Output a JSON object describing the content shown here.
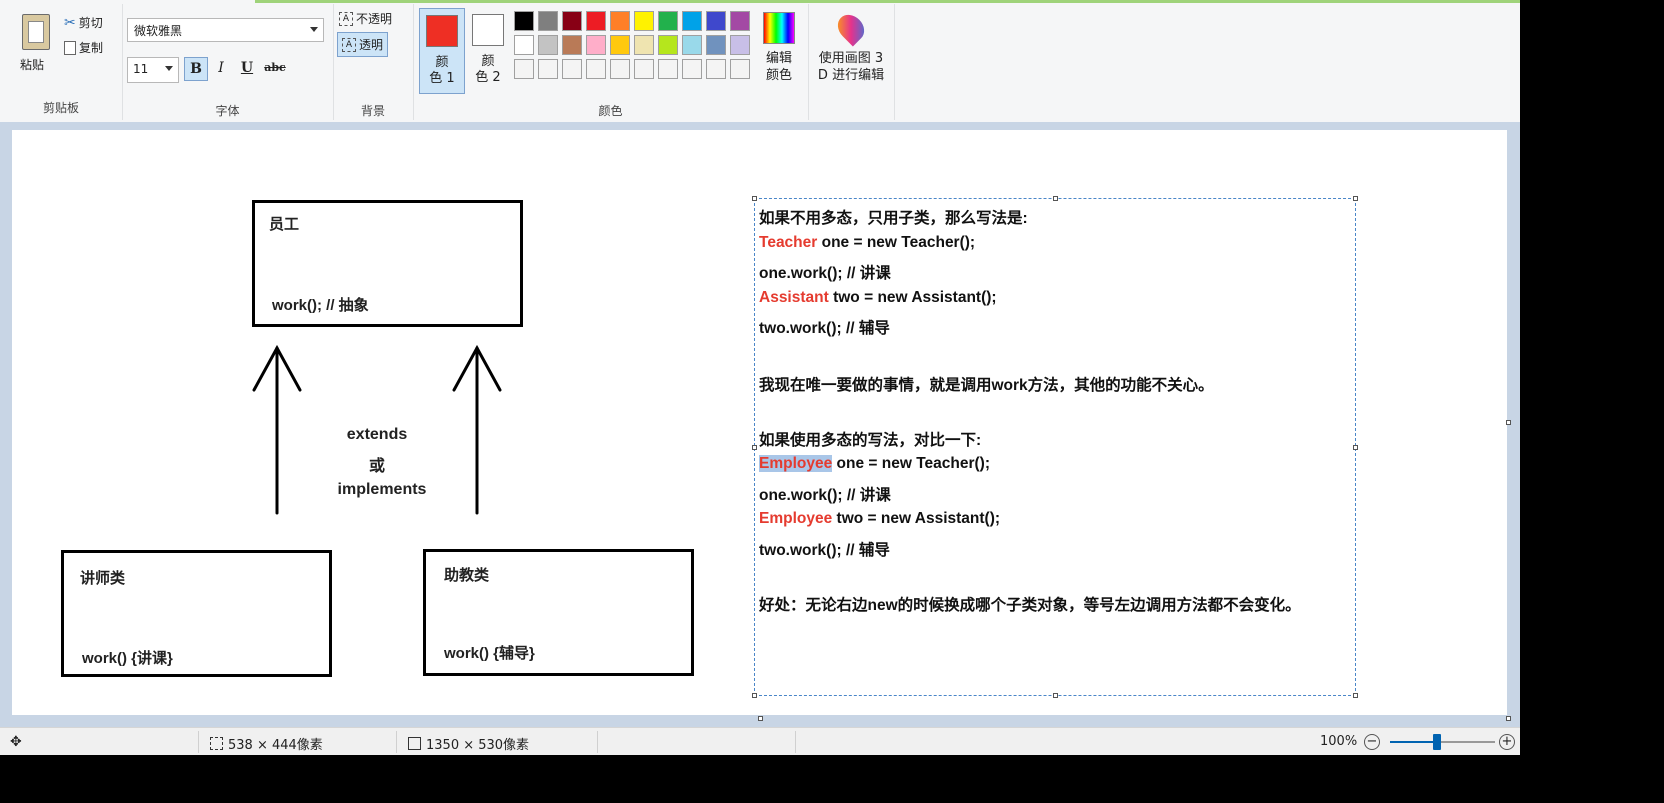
{
  "ribbon": {
    "clipboard": {
      "paste": "粘贴",
      "cut": "剪切",
      "copy": "复制",
      "group_label": "剪贴板"
    },
    "font": {
      "family": "微软雅黑",
      "size": "11",
      "bold": "B",
      "italic": "I",
      "underline": "U",
      "strike": "abc",
      "group_label": "字体"
    },
    "background": {
      "opaque": "不透明",
      "transparent": "透明",
      "group_label": "背景"
    },
    "colors": {
      "color1_label": "颜\n色 1",
      "color2_label": "颜\n色 2",
      "color1": "#ee2f24",
      "color2": "#ffffff",
      "edit_label": "编辑\n颜色",
      "group_label": "颜色",
      "palette": [
        "#000000",
        "#7f7f7f",
        "#880015",
        "#ed1c24",
        "#ff7f27",
        "#fff200",
        "#22b14c",
        "#00a2e8",
        "#3f48cc",
        "#a349a4",
        "#ffffff",
        "#c3c3c3",
        "#b97a57",
        "#ffaec9",
        "#ffc90e",
        "#efe4b0",
        "#b5e61d",
        "#99d9ea",
        "#7092be",
        "#c8bfe7",
        "#f4f4f4",
        "#f4f4f4",
        "#f4f4f4",
        "#f4f4f4",
        "#f4f4f4",
        "#f4f4f4",
        "#f4f4f4",
        "#f4f4f4",
        "#f4f4f4",
        "#f4f4f4"
      ]
    },
    "paint3d": {
      "label": "使用画图 3\nD 进行编辑"
    }
  },
  "diagram": {
    "parent_title": "员工",
    "parent_method": "work(); // 抽象",
    "relation_1": "extends",
    "relation_or": "或",
    "relation_2": "implements",
    "child1_title": "讲师类",
    "child1_method": "work() {讲课}",
    "child2_title": "助教类",
    "child2_method": "work() {辅导}"
  },
  "code_text": {
    "l1": "如果不用多态，只用子类，那么写法是:",
    "l2_type": "Teacher",
    "l2_rest": " one = new Teacher();",
    "l3": "one.work(); // 讲课",
    "l4_type": "Assistant",
    "l4_rest": " two = new Assistant();",
    "l5": "two.work(); // 辅导",
    "l6": "我现在唯一要做的事情，就是调用work方法，其他的功能不关心。",
    "l7": "如果使用多态的写法，对比一下:",
    "l8_type": "Employee",
    "l8_rest": " one = new Teacher();",
    "l9": "one.work(); // 讲课",
    "l10_type": "Employee",
    "l10_rest": " two = new Assistant();",
    "l11": "two.work(); // 辅导",
    "l12": "好处：无论右边new的时候换成哪个子类对象，等号左边调用方法都不会变化。"
  },
  "status": {
    "selection_size": "538 × 444像素",
    "canvas_size": "1350 × 530像素",
    "zoom": "100%",
    "zoom_level": 0.45
  }
}
